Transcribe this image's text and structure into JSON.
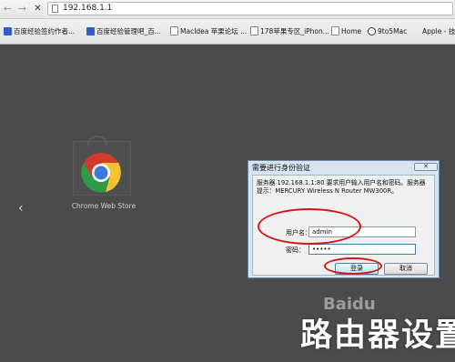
{
  "browser": {
    "url": "192.168.1.1",
    "bookmarks": [
      {
        "label": "百度经验签约作者...",
        "icon": "paw-icon"
      },
      {
        "label": "百度经验管理吧_百...",
        "icon": "paw-icon"
      },
      {
        "label": "MacIdea 苹果论坛 ...",
        "icon": "page-icon"
      },
      {
        "label": "178苹果专区_iPhon...",
        "icon": "page-icon"
      },
      {
        "label": "Home",
        "icon": "page-icon"
      },
      {
        "label": "9to5Mac",
        "icon": "clock-icon"
      },
      {
        "label": "Apple - 技",
        "icon": "apple-icon"
      }
    ]
  },
  "content": {
    "store_label": "Chrome Web Store"
  },
  "dialog": {
    "title": "需要进行身份验证",
    "message": "服务器 192.168.1.1:80 要求用户输入用户名和密码。服务器提示：MERCURY Wireless N Router MW300R。",
    "username_label": "用户名：",
    "username_value": "admin",
    "password_label": "密码：",
    "password_value": "•••••",
    "login_button": "登录",
    "cancel_button": "取消"
  },
  "watermark": {
    "logo_text": "Baidu",
    "title": "路由器设置"
  },
  "colors": {
    "highlight": "#d21616",
    "dialog_frame": "#d9e4f1",
    "page_background": "#4b4b4b"
  }
}
